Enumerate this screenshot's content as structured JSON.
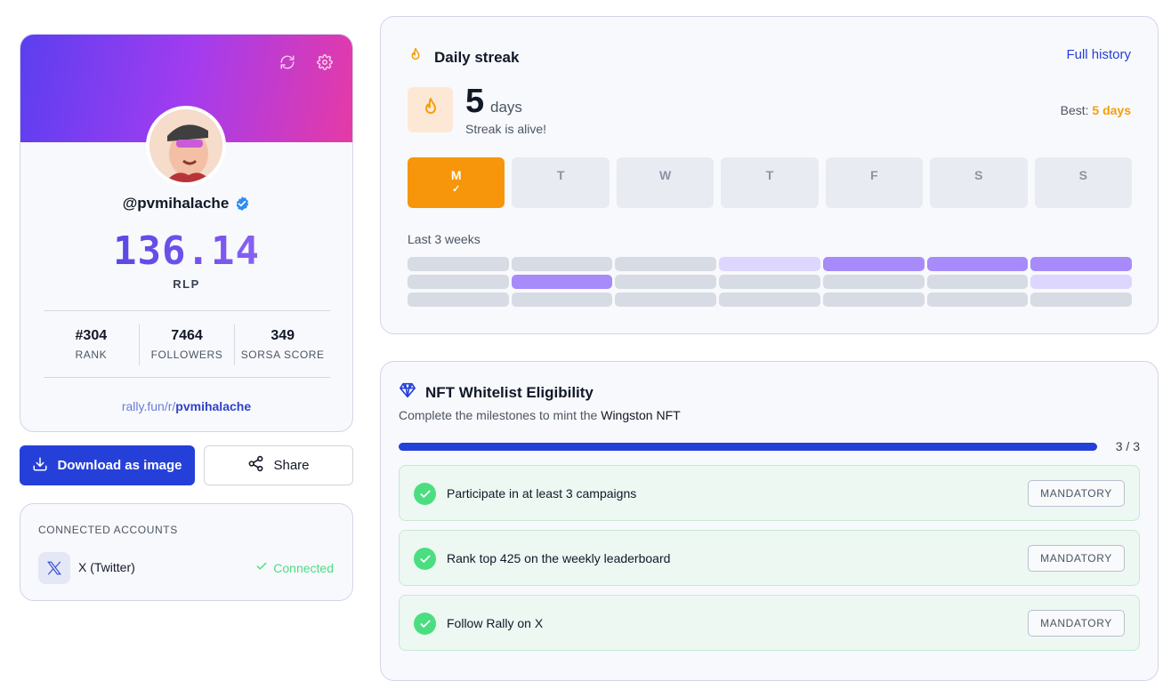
{
  "profile": {
    "handle": "@pvmihalache",
    "score": "136.14",
    "score_unit": "RLP",
    "stats": [
      {
        "value": "#304",
        "label": "RANK"
      },
      {
        "value": "7464",
        "label": "FOLLOWERS"
      },
      {
        "value": "349",
        "label": "SORSA SCORE"
      }
    ],
    "referral_prefix": "rally.fun/r/",
    "referral_user": "pvmihalache"
  },
  "actions": {
    "download_label": "Download as image",
    "share_label": "Share"
  },
  "accounts": {
    "title": "CONNECTED ACCOUNTS",
    "items": [
      {
        "name": "X (Twitter)",
        "status": "Connected"
      }
    ]
  },
  "streak": {
    "title": "Daily streak",
    "full_history_label": "Full history",
    "count": "5",
    "unit": "days",
    "subtitle": "Streak is alive!",
    "best_label": "Best:",
    "best_value": "5 days",
    "days": [
      {
        "label": "M",
        "active": true,
        "check": "✓"
      },
      {
        "label": "T",
        "active": false
      },
      {
        "label": "W",
        "active": false
      },
      {
        "label": "T",
        "active": false
      },
      {
        "label": "F",
        "active": false
      },
      {
        "label": "S",
        "active": false
      },
      {
        "label": "S",
        "active": false
      }
    ],
    "weeks_label": "Last 3 weeks",
    "weeks_levels": [
      [
        0,
        0,
        0,
        1,
        2,
        2,
        2
      ],
      [
        0,
        2,
        0,
        0,
        0,
        0,
        1
      ],
      [
        0,
        0,
        0,
        0,
        0,
        0,
        0
      ]
    ]
  },
  "nft": {
    "title": "NFT Whitelist Eligibility",
    "subtitle_prefix": "Complete the milestones to mint the",
    "subtitle_strong": "Wingston NFT",
    "progress_text": "3 / 3",
    "progress_fraction": 1.0,
    "milestones": [
      {
        "label": "Participate in at least 3 campaigns",
        "badge": "MANDATORY"
      },
      {
        "label": "Rank top 425 on the weekly leaderboard",
        "badge": "MANDATORY"
      },
      {
        "label": "Follow Rally on X",
        "badge": "MANDATORY"
      }
    ]
  },
  "colors": {
    "accent": "#2540d9",
    "streak_orange": "#f7960a",
    "success": "#4ade80",
    "activity_high": "#a78bfa",
    "activity_low": "#ddd6fe"
  }
}
